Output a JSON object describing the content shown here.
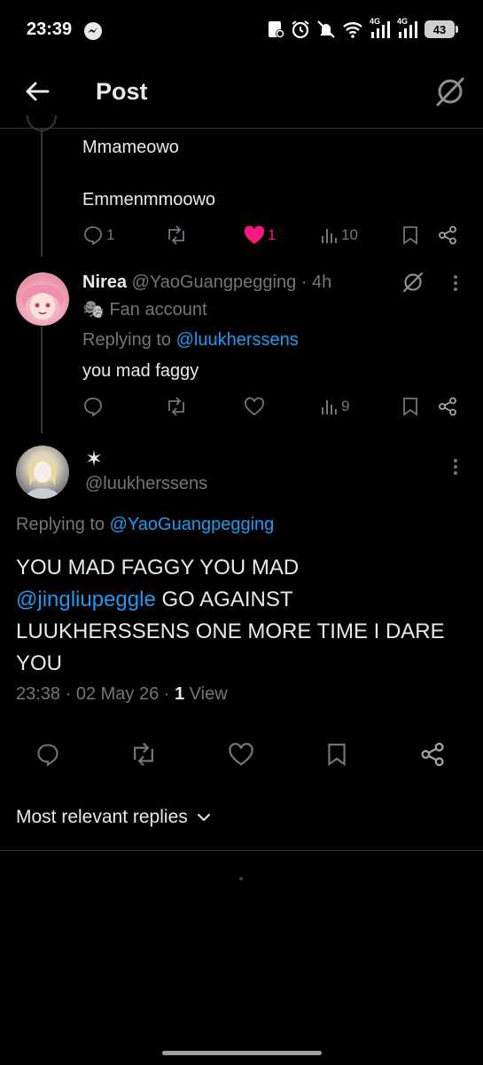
{
  "status_bar": {
    "time": "23:39",
    "battery": "43",
    "net1": "4G",
    "net2": "4G"
  },
  "header": {
    "title": "Post"
  },
  "parent_post": {
    "lines": [
      "Mmameowo",
      "Emmenmmoowo"
    ],
    "reply_count": "1",
    "like_count": "1",
    "view_count": "10"
  },
  "reply_post": {
    "display_name": "Nirea",
    "handle": "@YaoGuangpegging",
    "time": "· 4h",
    "label_emoji": "🎭",
    "label": "Fan account",
    "replying_prefix": "Replying to ",
    "replying_handle": "@luukherssens",
    "text": "you mad faggy",
    "view_count": "9"
  },
  "main_post": {
    "display_name": "✶",
    "handle": "@luukherssens",
    "replying_prefix": "Replying to ",
    "replying_handle": "@YaoGuangpegging",
    "text_part1": "YOU MAD FAGGY YOU MAD",
    "mention": "@jingliupeggle",
    "text_part2": " GO AGAINST LUUKHERSSENS ONE MORE TIME I DARE YOU",
    "timestamp": "23:38 · 02 May 26 · ",
    "view_num": "1",
    "view_word": " View"
  },
  "replies_sort": {
    "label": "Most relevant replies"
  },
  "colors": {
    "accent": "#1d9bf0",
    "like": "#f91880",
    "muted": "#71767b",
    "text": "#e7e9ea"
  }
}
